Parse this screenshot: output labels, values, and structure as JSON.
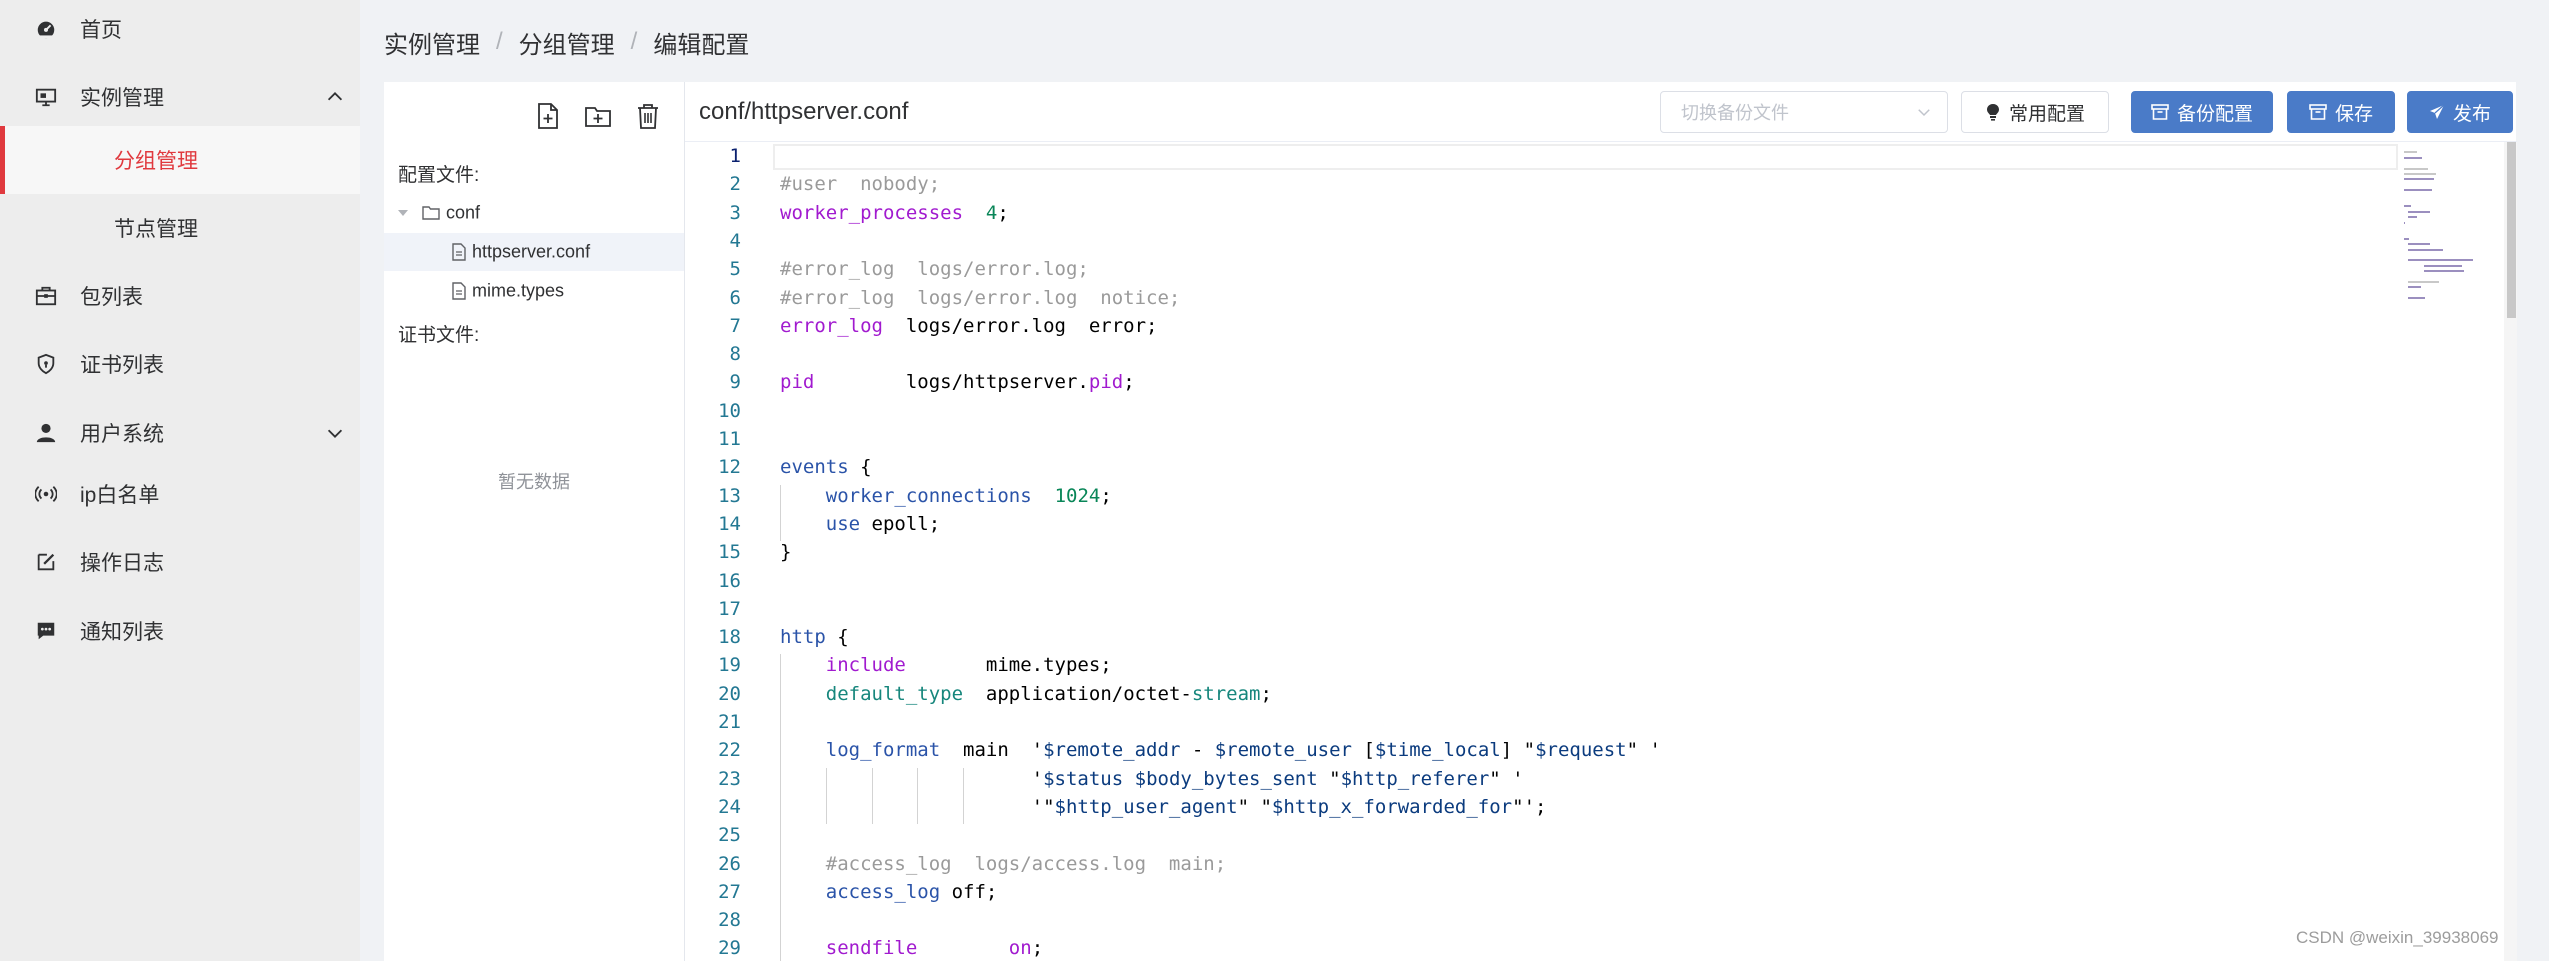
{
  "sidebar": {
    "items": [
      {
        "label": "首页",
        "icon": "dashboard-icon"
      },
      {
        "label": "实例管理",
        "icon": "monitor-icon",
        "expanded": true
      },
      {
        "label": "分组管理",
        "sub": true,
        "active": true
      },
      {
        "label": "节点管理",
        "sub": true
      },
      {
        "label": "包列表",
        "icon": "package-icon"
      },
      {
        "label": "证书列表",
        "icon": "shield-icon"
      },
      {
        "label": "用户系统",
        "icon": "user-icon",
        "expanded": false
      },
      {
        "label": "ip白名单",
        "icon": "wifi-icon"
      },
      {
        "label": "操作日志",
        "icon": "edit-icon"
      },
      {
        "label": "通知列表",
        "icon": "chat-icon"
      }
    ],
    "accent_color": "#e0393e"
  },
  "breadcrumb": [
    "实例管理",
    "分组管理",
    "编辑配置"
  ],
  "file_panel": {
    "config_label": "配置文件:",
    "folder": "conf",
    "files": [
      "httpserver.conf",
      "mime.types"
    ],
    "selected_file": "httpserver.conf",
    "cert_label": "证书文件:",
    "empty_text": "暂无数据",
    "tool_icons": [
      "new-file-icon",
      "new-folder-icon",
      "delete-icon"
    ]
  },
  "editor": {
    "title": "conf/httpserver.conf",
    "backup_select_placeholder": "切换备份文件",
    "common_config_label": "常用配置",
    "backup_label": "备份配置",
    "save_label": "保存",
    "publish_label": "发布",
    "primary_color": "#4a7bc8",
    "current_line": 1,
    "lines": [
      "",
      "#user  nobody;",
      "worker_processes  4;",
      "",
      "#error_log  logs/error.log;",
      "#error_log  logs/error.log  notice;",
      "error_log  logs/error.log  error;",
      "",
      "pid        logs/httpserver.pid;",
      "",
      "",
      "events {",
      "    worker_connections  1024;",
      "    use epoll;",
      "}",
      "",
      "",
      "http {",
      "    include       mime.types;",
      "    default_type  application/octet-stream;",
      "",
      "    log_format  main  '$remote_addr - $remote_user [$time_local] \"$request\" '",
      "                      '$status $body_bytes_sent \"$http_referer\" '",
      "                      '\"$http_user_agent\" \"$http_x_forwarded_for\"';",
      "",
      "    #access_log  logs/access.log  main;",
      "    access_log off;",
      "",
      "    sendfile        on;"
    ]
  },
  "watermark": "CSDN @weixin_39938069"
}
